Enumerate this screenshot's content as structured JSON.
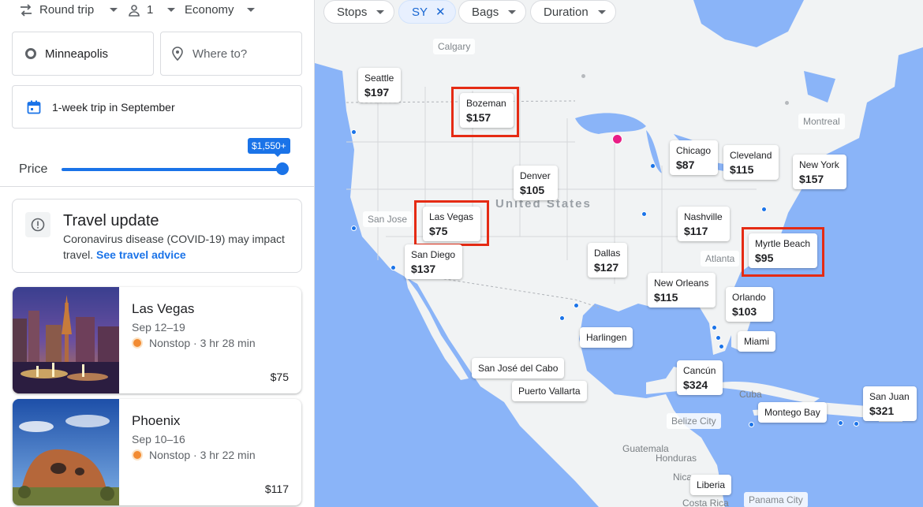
{
  "search": {
    "trip_type": "Round trip",
    "passengers": "1",
    "cabin": "Economy",
    "origin": "Minneapolis",
    "destination_placeholder": "Where to?",
    "dates": "1-week trip in September"
  },
  "price_filter": {
    "label": "Price",
    "max_value": "$1,550+",
    "fill_fraction": 1.0
  },
  "travel_update": {
    "title": "Travel update",
    "body": "Coronavirus disease (COVID-19) may impact travel.",
    "link": "See travel advice"
  },
  "results": [
    {
      "city": "Las Vegas",
      "dates": "Sep 12–19",
      "stops": "Nonstop · 3 hr 28 min",
      "price": "$75"
    },
    {
      "city": "Phoenix",
      "dates": "Sep 10–16",
      "stops": "Nonstop · 3 hr 22 min",
      "price": "$117"
    }
  ],
  "map_filters": {
    "stops": "Stops",
    "airline": "SY",
    "bags": "Bags",
    "duration": "Duration"
  },
  "map_pins": {
    "seattle": {
      "city": "Seattle",
      "price": "$197"
    },
    "bozeman": {
      "city": "Bozeman",
      "price": "$157"
    },
    "denver": {
      "city": "Denver",
      "price": "$105"
    },
    "las_vegas": {
      "city": "Las Vegas",
      "price": "$75"
    },
    "san_diego": {
      "city": "San Diego",
      "price": "$137"
    },
    "chicago": {
      "city": "Chicago",
      "price": "$87"
    },
    "cleveland": {
      "city": "Cleveland",
      "price": "$115"
    },
    "new_york": {
      "city": "New York",
      "price": "$157"
    },
    "nashville": {
      "city": "Nashville",
      "price": "$117"
    },
    "myrtle_beach": {
      "city": "Myrtle Beach",
      "price": "$95"
    },
    "dallas": {
      "city": "Dallas",
      "price": "$127"
    },
    "new_orleans": {
      "city": "New Orleans",
      "price": "$115"
    },
    "orlando": {
      "city": "Orlando",
      "price": "$103"
    },
    "cancun": {
      "city": "Cancún",
      "price": "$324"
    },
    "san_juan": {
      "city": "San Juan",
      "price": "$321"
    }
  },
  "map_named": {
    "harlingen": "Harlingen",
    "miami": "Miami",
    "san_jose_del_cabo": "San José del Cabo",
    "puerto_vallarta": "Puerto Vallarta",
    "montego_bay": "Montego Bay",
    "liberia": "Liberia"
  },
  "map_labels": {
    "calgary": "Calgary",
    "montreal": "Montreal",
    "san_jose": "San Jose",
    "atlanta": "Atlanta",
    "belize_city": "Belize City",
    "panama_city": "Panama City",
    "united_states": "United States",
    "cuba": "Cuba",
    "guatemala": "Guatemala",
    "honduras": "Honduras",
    "costa_rica": "Costa Rica",
    "nicaragua": "Nicar"
  },
  "colors": {
    "accent": "#1a73e8",
    "highlight": "#e52b14",
    "origin": "#e91e86",
    "water": "#8ab4f8",
    "land": "#f1f3f4"
  }
}
